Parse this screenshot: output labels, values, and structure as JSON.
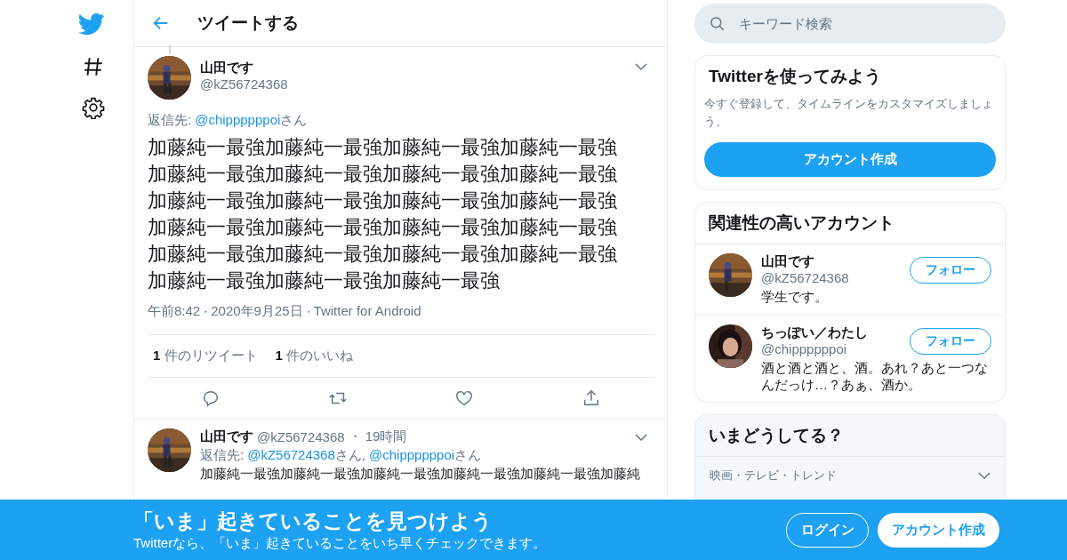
{
  "search": {
    "placeholder": "キーワード検索"
  },
  "header": {
    "title": "ツイートする"
  },
  "tweet": {
    "name": "山田です",
    "handle": "@kZ56724368",
    "reply_label": "返信先:",
    "reply_to": [
      {
        "handle": "@chippppppoi",
        "suffix": "さん"
      }
    ],
    "text": "加藤純一最強加藤純一最強加藤純一最強加藤純一最強加藤純一最強加藤純一最強加藤純一最強加藤純一最強加藤純一最強加藤純一最強加藤純一最強加藤純一最強加藤純一最強加藤純一最強加藤純一最強加藤純一最強加藤純一最強加藤純一最強加藤純一最強加藤純一最強加藤純一最強加藤純一最強加藤純一最強",
    "time": "午前8:42",
    "separator": "・",
    "date": "2020年9月25日",
    "separator_2": "・",
    "source": "Twitter for Android",
    "stats": [
      {
        "count": "1",
        "label": "件のリツイート"
      },
      {
        "count": "1",
        "label": "件のいいね"
      }
    ],
    "actions": [
      {
        "kind": "reply"
      },
      {
        "kind": "retweet"
      },
      {
        "kind": "like"
      },
      {
        "kind": "share"
      }
    ]
  },
  "reply": {
    "name": "山田です",
    "handle": "@kZ56724368",
    "separator": "・",
    "time": "19時間",
    "reply_label": "返信先:",
    "reply_to": [
      {
        "handle": "@kZ56724368",
        "suffix": "さん,"
      },
      {
        "handle": "@chippppppoi",
        "suffix": "さん"
      }
    ],
    "text": "加藤純一最強加藤純一最強加藤純一最強加藤純一最強加藤純一最強加藤純"
  },
  "signup": {
    "title": "Twitterを使ってみよう",
    "text": "今すぐ登録して、タイムラインをカスタマイズしましょう。",
    "button": "アカウント作成"
  },
  "related": {
    "title": "関連性の高いアカウント",
    "accounts": [
      {
        "name": "山田です",
        "handle": "@kZ56724368",
        "bio": "学生です。",
        "button": "フォロー"
      },
      {
        "name": "ちっぽい／わたし",
        "handle": "@chippppppoi",
        "bio": "酒と酒と酒と、酒。あれ？あと一つなんだっけ…？あぁ、酒か。",
        "button": "フォロー"
      }
    ]
  },
  "trends": {
    "title": "いまどうしてる？",
    "items": [
      {
        "category": "映画・テレビ・トレンド"
      }
    ]
  },
  "banner": {
    "title": "「いま」起きていることを見つけよう",
    "text": "Twitterなら、「いま」起きていることをいち早くチェックできます。",
    "login": "ログイン",
    "signup": "アカウント作成"
  }
}
